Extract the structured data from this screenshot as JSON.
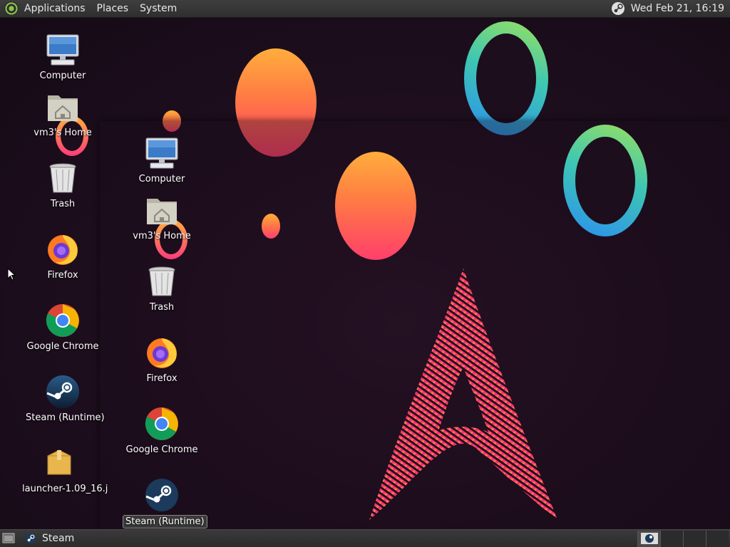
{
  "top_panel": {
    "menus": [
      "Applications",
      "Places",
      "System"
    ],
    "clock": "Wed Feb 21, 16:19"
  },
  "desktop_col1": [
    {
      "label": "Computer",
      "icon": "computer-icon"
    },
    {
      "label": "vm3's Home",
      "icon": "home-folder-icon"
    },
    {
      "label": "Trash",
      "icon": "trash-icon"
    },
    {
      "label": "Firefox",
      "icon": "firefox-icon"
    },
    {
      "label": "Google Chrome",
      "icon": "chrome-icon"
    },
    {
      "label": "Steam (Runtime)",
      "icon": "steam-icon"
    },
    {
      "label": "launcher-1.09_16.j",
      "icon": "package-icon"
    }
  ],
  "desktop_col2": [
    {
      "label": "Computer",
      "icon": "computer-icon"
    },
    {
      "label": "vm3's Home",
      "icon": "home-folder-icon"
    },
    {
      "label": "Trash",
      "icon": "trash-icon"
    },
    {
      "label": "Firefox",
      "icon": "firefox-icon"
    },
    {
      "label": "Google Chrome",
      "icon": "chrome-icon"
    },
    {
      "label": "Steam (Runtime)",
      "icon": "steam-icon",
      "selected": true
    }
  ],
  "taskbar": {
    "tasks": [
      {
        "label": "Steam",
        "icon": "steam-icon"
      }
    ],
    "workspaces": 4,
    "active_workspace": 1
  },
  "colors": {
    "wallpaper_bg": "#1d0e1d",
    "panel_bg": "#333333",
    "arch_logo_pink": "#ff2a7a",
    "arch_logo_yellow": "#ffd23c"
  }
}
